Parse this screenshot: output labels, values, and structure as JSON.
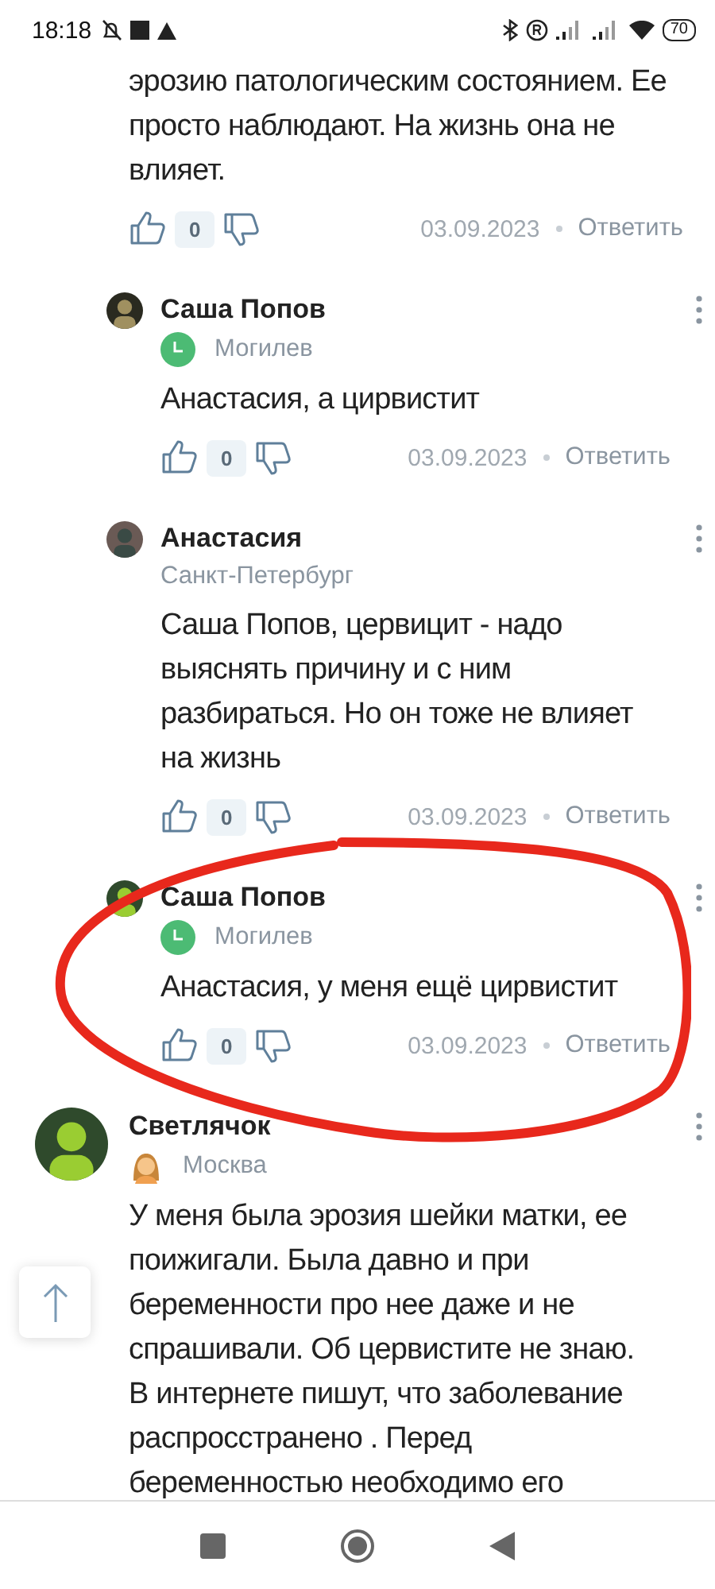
{
  "status_bar": {
    "time": "18:18",
    "battery": "70"
  },
  "comments": [
    {
      "kind": "continued",
      "text": "эрозию патологическим состоянием. Ее просто наблюдают. На жизнь она не влияет.",
      "likes": "0",
      "date": "03.09.2023",
      "reply": "Ответить"
    },
    {
      "kind": "reply",
      "author": "Саша Попов",
      "badge": {
        "kind": "clock"
      },
      "location": "Могилев",
      "text": "Анастасия, а цирвистит",
      "likes": "0",
      "date": "03.09.2023",
      "reply": "Ответить"
    },
    {
      "kind": "reply",
      "author": "Анастасия",
      "location": "Санкт-Петербург",
      "text": "Саша Попов, цервицит - надо выяснять причину и с ним разбираться. Но он тоже не влияет на жизнь",
      "likes": "0",
      "date": "03.09.2023",
      "reply": "Ответить"
    },
    {
      "kind": "reply",
      "author": "Саша Попов",
      "badge": {
        "kind": "clock"
      },
      "location": "Могилев",
      "text": "Анастасия, у меня ещё цирвистит",
      "likes": "0",
      "date": "03.09.2023",
      "reply": "Ответить"
    },
    {
      "kind": "top",
      "author": "Светлячок",
      "badge": {
        "kind": "girl"
      },
      "location": "Москва",
      "text": "У меня была эрозия шейки матки, ее поижигали. Была давно и при беременности про нее даже и не спрашивали. Об цервистите не знаю. В интернете пишут, что заболевание распросстранено . Перед беременностью необходимо его"
    }
  ]
}
